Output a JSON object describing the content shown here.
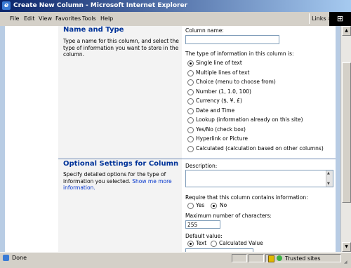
{
  "window": {
    "title": "Create New Column - Microsoft Internet Explorer"
  },
  "menu": {
    "file": "File",
    "edit": "Edit",
    "view": "View",
    "favorites": "Favorites",
    "tools": "Tools",
    "help": "Help",
    "links": "Links »"
  },
  "section1": {
    "title": "Name and Type",
    "description": "Type a name for this column, and select the type of information you want to store in the column.",
    "column_name_label": "Column name:",
    "column_name_value": "",
    "type_label": "The type of information in this column is:",
    "types": [
      {
        "label": "Single line of text",
        "selected": true
      },
      {
        "label": "Multiple lines of text",
        "selected": false
      },
      {
        "label": "Choice (menu to choose from)",
        "selected": false
      },
      {
        "label": "Number (1, 1.0, 100)",
        "selected": false
      },
      {
        "label": "Currency ($, ¥, £)",
        "selected": false
      },
      {
        "label": "Date and Time",
        "selected": false
      },
      {
        "label": "Lookup (information already on this site)",
        "selected": false
      },
      {
        "label": "Yes/No (check box)",
        "selected": false
      },
      {
        "label": "Hyperlink or Picture",
        "selected": false
      },
      {
        "label": "Calculated (calculation based on other columns)",
        "selected": false
      }
    ]
  },
  "section2": {
    "title": "Optional Settings for Column",
    "description": "Specify detailed options for the type of information you selected.",
    "more_link": "Show me more information.",
    "description_label": "Description:",
    "require_label": "Require that this column contains information:",
    "yes_label": "Yes",
    "no_label": "No",
    "require_selected": "No",
    "max_chars_label": "Maximum number of characters:",
    "max_chars_value": "255",
    "default_label": "Default value:",
    "default_text_label": "Text",
    "default_calc_label": "Calculated Value",
    "default_selected": "Text"
  },
  "status": {
    "text": "Done",
    "zone": "Trusted sites"
  },
  "colors": {
    "heading": "#003399",
    "title_bar": "#0a246a"
  }
}
